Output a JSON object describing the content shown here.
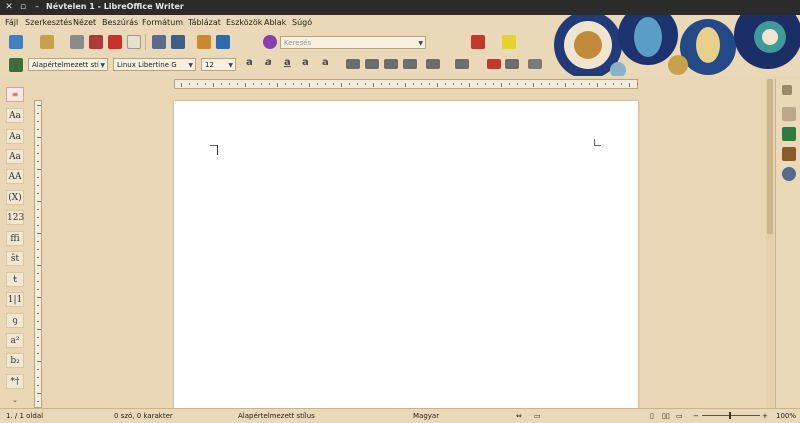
{
  "window": {
    "title": "Névtelen 1 - LibreOffice Writer"
  },
  "menu": [
    "Fájl",
    "Szerkesztés",
    "Nézet",
    "Beszúrás",
    "Formátum",
    "Táblázat",
    "Eszközök",
    "Ablak",
    "Súgó"
  ],
  "toolbar": {
    "search_placeholder": "Keresés",
    "paragraph_style": "Alapértelmezett stí",
    "font_name": "Linux Libertine G",
    "font_size": "12"
  },
  "left_panel": [
    "Aa",
    "Aa",
    "Aa",
    "AA",
    "(X)",
    "123",
    "ffi",
    "ŝt",
    "ŧ",
    "1|1",
    "ꝯ",
    "a²",
    "b₂",
    "*†"
  ],
  "status": {
    "page": "1. / 1 oldal",
    "words": "0 szó, 0 karakter",
    "style": "Alapértelmezett stílus",
    "language": "Magyar",
    "zoom": "100%"
  }
}
